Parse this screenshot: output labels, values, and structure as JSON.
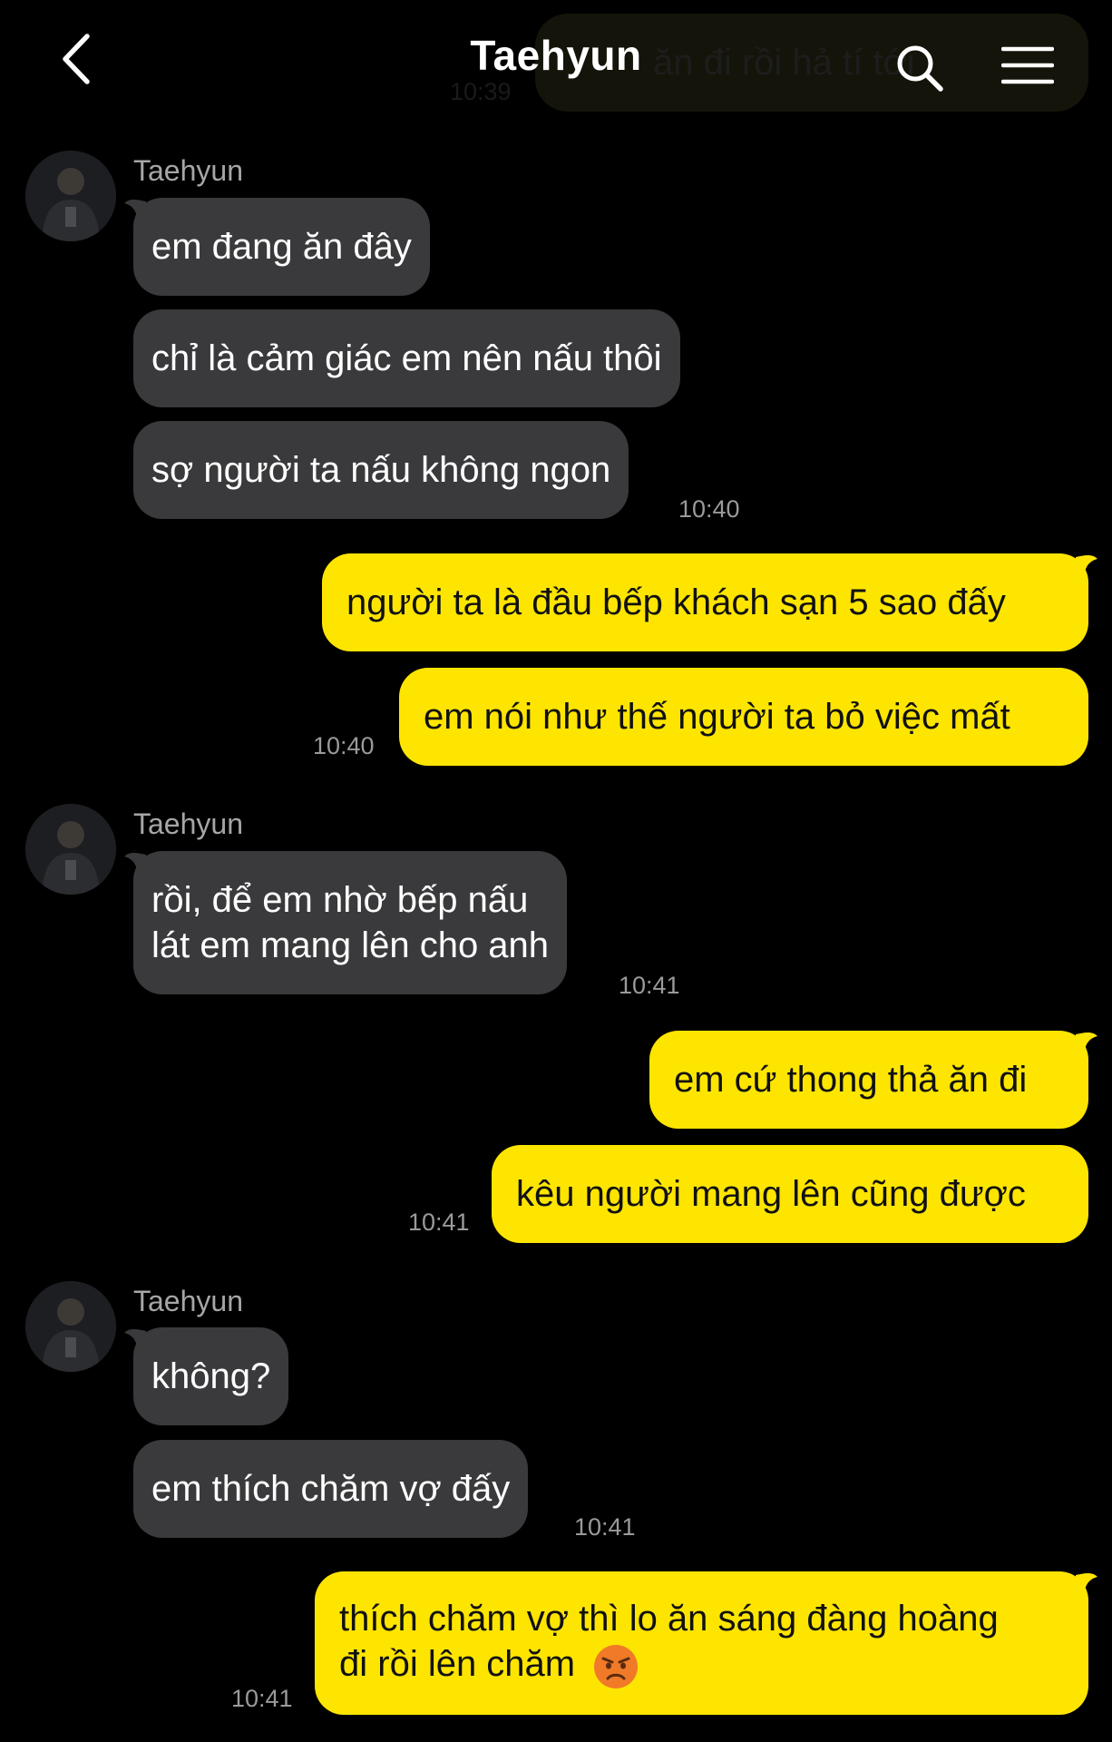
{
  "header": {
    "title": "Taehyun",
    "ghost_message": "ăn đi rồi hả tí tới",
    "ghost_time": "10:39"
  },
  "colors": {
    "background": "#000000",
    "incoming_bubble": "#3a3a3c",
    "outgoing_bubble": "#fee500",
    "time_text": "#9a9a9a"
  },
  "groups": [
    {
      "sender": "Taehyun",
      "messages": [
        "em đang ăn đây",
        "chỉ là cảm giác em nên nấu thôi",
        "sợ người ta nấu không ngon"
      ],
      "time": "10:40"
    },
    {
      "sender": "me",
      "messages": [
        "người ta là đầu bếp khách sạn 5 sao đấy",
        "em nói như thế người ta bỏ việc mất"
      ],
      "time": "10:40"
    },
    {
      "sender": "Taehyun",
      "messages": [
        [
          "rồi, để em nhờ bếp nấu",
          "lát em mang lên cho anh"
        ]
      ],
      "time": "10:41"
    },
    {
      "sender": "me",
      "messages": [
        "em cứ thong thả ăn đi",
        "kêu người mang lên cũng được"
      ],
      "time": "10:41"
    },
    {
      "sender": "Taehyun",
      "messages": [
        "không?",
        "em thích chăm vợ đấy"
      ],
      "time": "10:41"
    },
    {
      "sender": "me",
      "messages": [
        [
          "thích chăm vợ thì lo ăn sáng đàng hoàng",
          "đi rồi lên chăm"
        ]
      ],
      "emoji": "angry-face-icon",
      "time": "10:41"
    }
  ]
}
